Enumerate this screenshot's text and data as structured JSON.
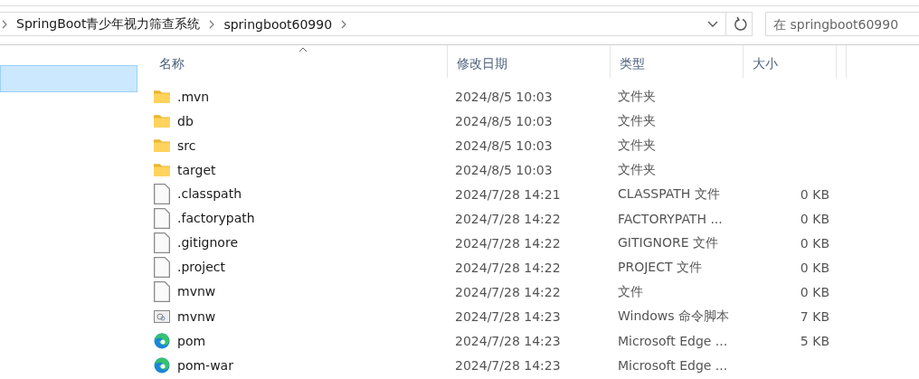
{
  "address_bar": {
    "breadcrumbs": [
      "SpringBoot青少年视力筛查系统",
      "springboot60990"
    ]
  },
  "search": {
    "placeholder": "在 springboot60990"
  },
  "nav_pane": {
    "items": [
      {
        "selected": true
      }
    ]
  },
  "columns": [
    {
      "label": "名称",
      "sorted": true
    },
    {
      "label": "修改日期",
      "sorted": false
    },
    {
      "label": "类型",
      "sorted": false
    },
    {
      "label": "大小",
      "sorted": false
    }
  ],
  "rows": [
    {
      "kind": "folder",
      "name": ".mvn",
      "date": "2024/8/5 10:03",
      "type": "文件夹"
    },
    {
      "kind": "folder",
      "name": "db",
      "date": "2024/8/5 10:03",
      "type": "文件夹"
    },
    {
      "kind": "folder",
      "name": "src",
      "date": "2024/8/5 10:03",
      "type": "文件夹"
    },
    {
      "kind": "folder",
      "name": "target",
      "date": "2024/8/5 10:03",
      "type": "文件夹"
    },
    {
      "kind": "file",
      "name": ".classpath",
      "date": "2024/7/28 14:21",
      "type": "CLASSPATH 文件",
      "size": "0 KB"
    },
    {
      "kind": "file",
      "name": ".factorypath",
      "date": "2024/7/28 14:22",
      "type": "FACTORYPATH ...",
      "size": "0 KB"
    },
    {
      "kind": "file",
      "name": ".gitignore",
      "date": "2024/7/28 14:22",
      "type": "GITIGNORE 文件",
      "size": "0 KB"
    },
    {
      "kind": "file",
      "name": ".project",
      "date": "2024/7/28 14:22",
      "type": "PROJECT 文件",
      "size": "0 KB"
    },
    {
      "kind": "file",
      "name": "mvnw",
      "date": "2024/7/28 14:22",
      "type": "文件",
      "size": "0 KB"
    },
    {
      "kind": "script",
      "name": "mvnw",
      "date": "2024/7/28 14:23",
      "type": "Windows 命令脚本",
      "size": "7 KB"
    },
    {
      "kind": "edge",
      "name": "pom",
      "date": "2024/7/28 14:23",
      "type": "Microsoft Edge ...",
      "size": "5 KB"
    },
    {
      "kind": "edge",
      "name": "pom-war",
      "date": "2024/7/28 14:23",
      "type": "Microsoft Edge ..."
    }
  ]
}
